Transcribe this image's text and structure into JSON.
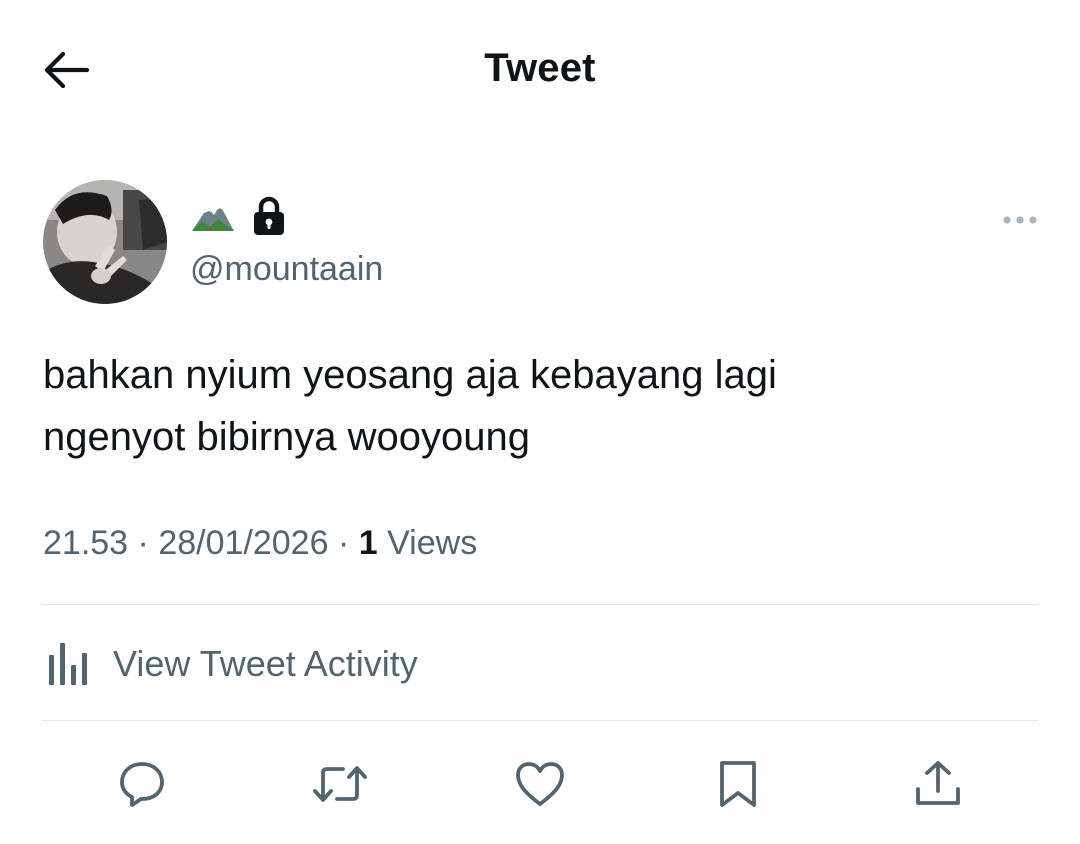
{
  "header": {
    "title": "Tweet"
  },
  "author": {
    "display_emoji": "mountain-emoji",
    "locked": true,
    "handle": "@mountaain"
  },
  "tweet": {
    "text_line1": "bahkan nyium yeosang aja kebayang lagi",
    "text_line2": "ngenyot bibirnya wooyoung",
    "time": "21.53",
    "date": "28/01/2026",
    "views_count": "1",
    "views_label": "Views",
    "separator": "·"
  },
  "activity": {
    "label": "View Tweet Activity"
  },
  "colors": {
    "text_primary": "#0f1419",
    "text_secondary": "#536471",
    "divider": "#e1e6ea"
  },
  "icons": {
    "back": "arrow-left-icon",
    "more": "more-horizontal-icon",
    "lock": "lock-icon",
    "analytics": "bar-chart-icon",
    "reply": "reply-icon",
    "retweet": "retweet-icon",
    "like": "heart-icon",
    "bookmark": "bookmark-icon",
    "share": "share-icon"
  }
}
